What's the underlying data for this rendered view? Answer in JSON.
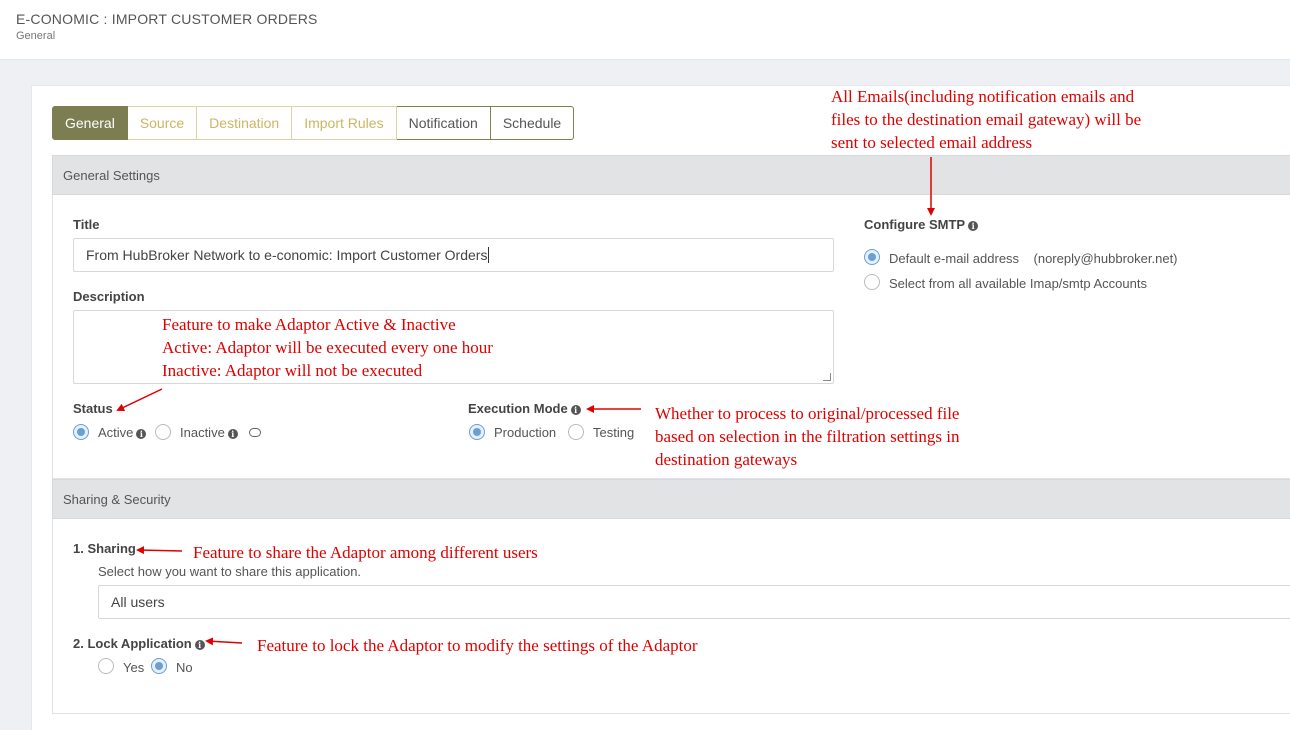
{
  "header": {
    "title": "E-CONOMIC : IMPORT CUSTOMER ORDERS",
    "subtitle": "General"
  },
  "tabs": [
    {
      "label": "General",
      "state": "active"
    },
    {
      "label": "Source",
      "state": "disabled"
    },
    {
      "label": "Destination",
      "state": "disabled"
    },
    {
      "label": "Import Rules",
      "state": "disabled"
    },
    {
      "label": "Notification",
      "state": "normal"
    },
    {
      "label": "Schedule",
      "state": "normal"
    }
  ],
  "general_settings": {
    "heading": "General Settings",
    "title_label": "Title",
    "title_value": "From HubBroker Network to e-conomic: Import Customer Orders",
    "description_label": "Description",
    "description_value": "",
    "status_label": "Status",
    "status_options": {
      "active": "Active",
      "inactive": "Inactive"
    },
    "status_selected": "Active",
    "execution_mode_label": "Execution Mode",
    "execution_options": {
      "production": "Production",
      "testing": "Testing"
    },
    "execution_selected": "Production",
    "smtp_label": "Configure SMTP",
    "smtp_options": {
      "default": "Default e-mail address",
      "default_address": "(noreply@hubbroker.net)",
      "select_all": "Select from all available Imap/smtp Accounts"
    },
    "smtp_selected": "Default e-mail address"
  },
  "sharing_security": {
    "heading": "Sharing & Security",
    "sharing_label": "1. Sharing",
    "sharing_hint": "Select how you want to share this application.",
    "sharing_value": "All users",
    "lock_label": "2. Lock Application",
    "lock_options": {
      "yes": "Yes",
      "no": "No"
    },
    "lock_selected": "No"
  },
  "annotations": {
    "smtp": [
      "All Emails(including notification emails and",
      "files to the destination email gateway) will be",
      "sent to selected email address"
    ],
    "status": [
      "Feature to make Adaptor Active & Inactive",
      "Active: Adaptor will be executed every one hour",
      "Inactive: Adaptor will not be executed"
    ],
    "execution": [
      "Whether to process to original/processed file",
      "based on selection in the filtration settings in",
      "destination gateways"
    ],
    "sharing": "Feature to share the Adaptor among different users",
    "lock": "Feature to lock the Adaptor to modify the settings of the Adaptor"
  },
  "colors": {
    "tab_active": "#7d7d52",
    "tab_disabled_text": "#cdb565",
    "radio_checked": "#6a9fd4",
    "annotation": "#e00000"
  }
}
